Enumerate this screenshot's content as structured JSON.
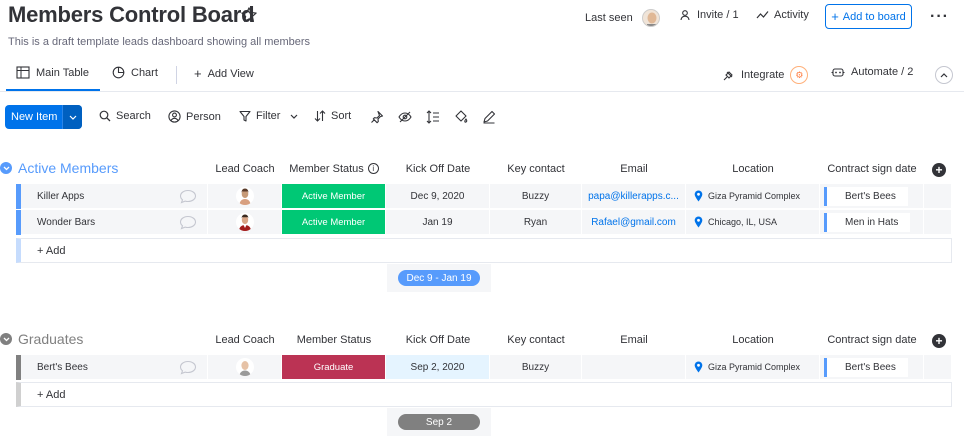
{
  "header": {
    "title": "Members Control Board",
    "subtitle": "This is a draft template leads dashboard showing all members",
    "last_seen": "Last seen",
    "invite": "Invite / 1",
    "activity": "Activity",
    "add_to_board": "Add to board"
  },
  "tabs": {
    "main_table": "Main Table",
    "chart": "Chart",
    "add_view": "Add View",
    "integrate": "Integrate",
    "automate": "Automate / 2"
  },
  "toolbar": {
    "new_item": "New Item",
    "search": "Search",
    "person": "Person",
    "filter": "Filter",
    "sort": "Sort"
  },
  "columns": [
    "Lead Coach",
    "Member Status",
    "Kick Off Date",
    "Key contact",
    "Email",
    "Location",
    "Contract sign date"
  ],
  "groups": [
    {
      "title": "Active Members",
      "color": "#579bfc",
      "rows": [
        {
          "name": "Killer Apps",
          "status": "Active Member",
          "status_color": "#00c875",
          "kickoff": "Dec 9, 2020",
          "contact": "Buzzy",
          "email": "papa@killerapps.c...",
          "location": "Giza Pyramid Complex",
          "contract": "Bert's Bees"
        },
        {
          "name": "Wonder Bars",
          "status": "Active Member",
          "status_color": "#00c875",
          "kickoff": "Jan 19",
          "contact": "Ryan",
          "email": "Rafael@gmail.com",
          "location": "Chicago, IL, USA",
          "contract": "Men in Hats"
        }
      ],
      "add_label": "+ Add",
      "summary": "Dec 9 - Jan 19",
      "summary_color": "#579bfc"
    },
    {
      "title": "Graduates",
      "color": "#808080",
      "rows": [
        {
          "name": "Bert's Bees",
          "status": "Graduate",
          "status_color": "#bb3354",
          "kickoff": "Sep 2, 2020",
          "contact": "Buzzy",
          "email": "",
          "location": "Giza Pyramid Complex",
          "contract": "Bert's Bees"
        }
      ],
      "add_label": "+ Add",
      "summary": "Sep 2",
      "summary_color": "#808080"
    }
  ]
}
